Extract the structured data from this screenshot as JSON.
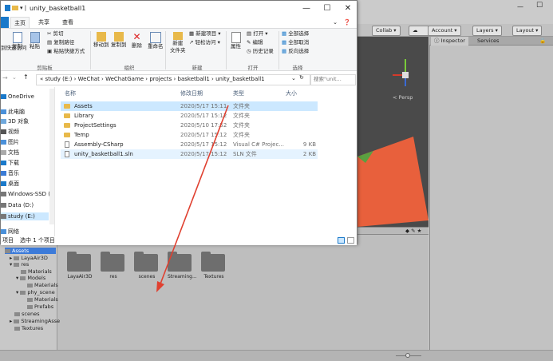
{
  "explorer": {
    "title": "unity_basketball1",
    "qa_sep": "▾ |",
    "tabs": [
      "文件",
      "主页",
      "共享",
      "查看"
    ],
    "ribbon": {
      "clipboard": {
        "group": "剪贴板",
        "pin_partial": "到快速访问",
        "copy": "复制",
        "paste": "粘贴",
        "cut": "剪切",
        "copy_path": "复制路径",
        "paste_shortcut": "粘贴快捷方式"
      },
      "organize": {
        "group": "组织",
        "move_to": "移动到",
        "copy_to": "复制到",
        "delete": "删除",
        "rename": "重命名"
      },
      "new": {
        "group": "新建",
        "new_folder": "新建\n文件夹",
        "new_item": "新建项目 ▾",
        "easy_access": "轻松访问 ▾"
      },
      "open": {
        "group": "打开",
        "properties": "属性",
        "open": "打开 ▾",
        "edit": "编辑",
        "history": "历史记录"
      },
      "select": {
        "group": "选择",
        "select_all": "全部选择",
        "select_none": "全部取消",
        "invert": "反向选择"
      }
    },
    "address": "« study (E:)  ›  WeChat  ›  WeChatGame  ›  projects  ›  basketball1  ›  unity_basketball1",
    "search_placeholder": "搜索\"unit...",
    "nav": [
      "OneDrive",
      "此电脑",
      "3D 对象",
      "视频",
      "图片",
      "文档",
      "下载",
      "音乐",
      "桌面",
      "Windows-SSD (C",
      "Data (D:)",
      "study (E:)",
      "网络"
    ],
    "columns": {
      "name": "名称",
      "date": "修改日期",
      "type": "类型",
      "size": "大小"
    },
    "files": [
      {
        "name": "Assets",
        "date": "2020/5/17 15:11",
        "type": "文件夹",
        "size": "",
        "kind": "folder"
      },
      {
        "name": "Library",
        "date": "2020/5/17 15:12",
        "type": "文件夹",
        "size": "",
        "kind": "folder"
      },
      {
        "name": "ProjectSettings",
        "date": "2020/5/10 17:52",
        "type": "文件夹",
        "size": "",
        "kind": "folder"
      },
      {
        "name": "Temp",
        "date": "2020/5/17 15:12",
        "type": "文件夹",
        "size": "",
        "kind": "folder"
      },
      {
        "name": "Assembly-CSharp",
        "date": "2020/5/17 15:12",
        "type": "Visual C# Projec...",
        "size": "9 KB",
        "kind": "file"
      },
      {
        "name": "unity_basketball1.sln",
        "date": "2020/5/17 15:12",
        "type": "SLN 文件",
        "size": "2 KB",
        "kind": "file"
      }
    ],
    "status_count": "项目",
    "status_selected": "选中 1 个项目"
  },
  "unity": {
    "toolbar": {
      "collab": "Collab ▾",
      "account": "Account ▾",
      "layers": "Layers ▾",
      "layout": "Layout ▾"
    },
    "tabs": {
      "inspector": "Inspector",
      "services": "Services"
    },
    "persp": "< Persp",
    "tree": [
      "Assets",
      "LayaAir3D",
      "res",
      "Materials",
      "Models",
      "Materials",
      "phy_scene",
      "Materials",
      "Prefabs",
      "scenes",
      "StreamingAsse",
      "Textures"
    ],
    "folders": [
      "LayaAir3D",
      "res",
      "scenes",
      "Streaming...",
      "Textures"
    ]
  },
  "colors": {
    "accent": "#1979ca",
    "selection": "#cce8ff",
    "folder": "#e8b94a",
    "arrow": "#e04030",
    "scene_shape": "#e8603c"
  }
}
